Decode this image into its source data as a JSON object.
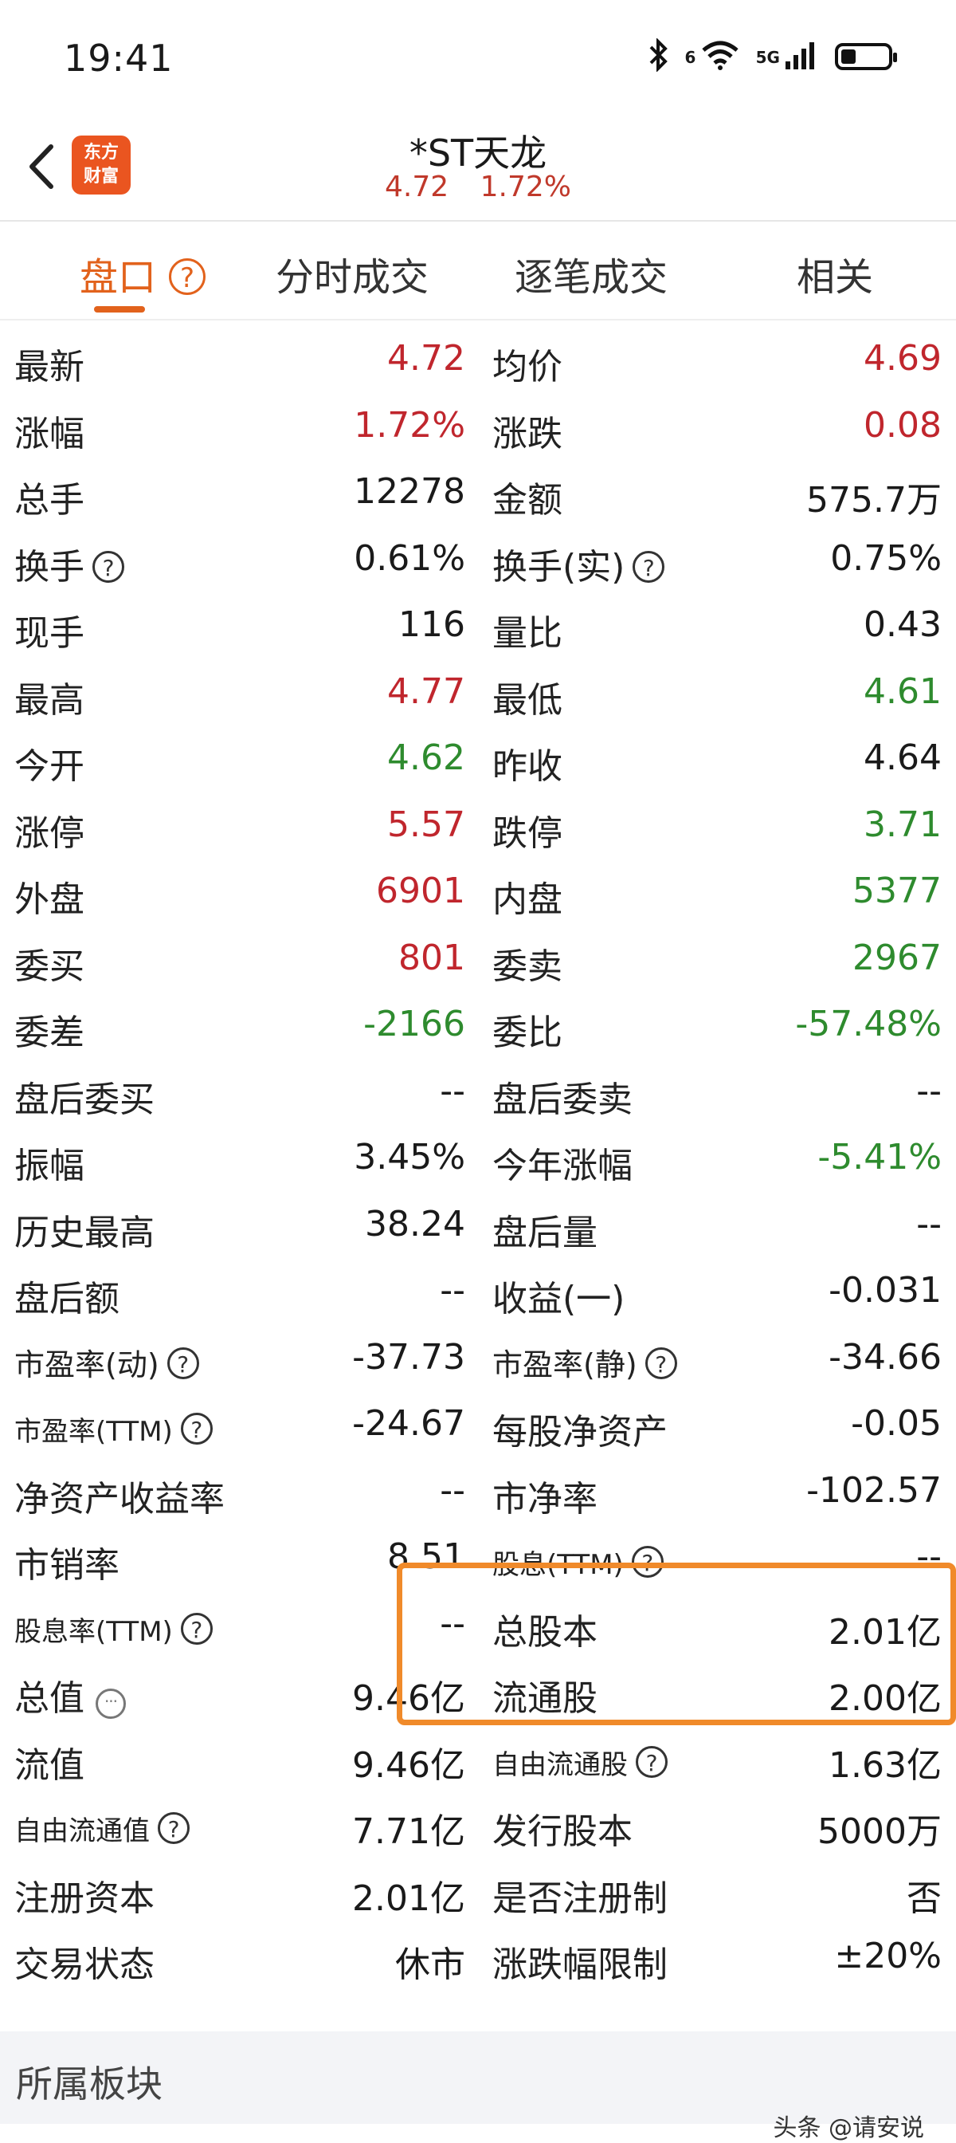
{
  "status_bar": {
    "time": "19:41",
    "icons": [
      "bluetooth-icon",
      "wifi-icon",
      "signal-icon",
      "battery-icon"
    ],
    "wifi_badge": "6",
    "network": "5G"
  },
  "header": {
    "back_icon": "chevron-left-icon",
    "logo_line1": "东方",
    "logo_line2": "财富",
    "stock_name": "*ST天龙",
    "price": "4.72",
    "change_pct": "1.72%"
  },
  "tabs": [
    {
      "label": "盘口",
      "active": true
    },
    {
      "label": "分时成交",
      "active": false
    },
    {
      "label": "逐笔成交",
      "active": false
    },
    {
      "label": "相关",
      "active": false
    }
  ],
  "rows": [
    {
      "l_label": "最新",
      "l_value": "4.72",
      "r_label": "均价",
      "r_value": "4.69"
    },
    {
      "l_label": "涨幅",
      "l_value": "1.72%",
      "r_label": "涨跌",
      "r_value": "0.08"
    },
    {
      "l_label": "总手",
      "l_value": "12278",
      "r_label": "金额",
      "r_value": "575.7万"
    },
    {
      "l_label": "换手",
      "l_value": "0.61%",
      "r_label": "换手(实)",
      "r_value": "0.75%"
    },
    {
      "l_label": "现手",
      "l_value": "116",
      "r_label": "量比",
      "r_value": "0.43"
    },
    {
      "l_label": "最高",
      "l_value": "4.77",
      "r_label": "最低",
      "r_value": "4.61"
    },
    {
      "l_label": "今开",
      "l_value": "4.62",
      "r_label": "昨收",
      "r_value": "4.64"
    },
    {
      "l_label": "涨停",
      "l_value": "5.57",
      "r_label": "跌停",
      "r_value": "3.71"
    },
    {
      "l_label": "外盘",
      "l_value": "6901",
      "r_label": "内盘",
      "r_value": "5377"
    },
    {
      "l_label": "委买",
      "l_value": "801",
      "r_label": "委卖",
      "r_value": "2967"
    },
    {
      "l_label": "委差",
      "l_value": "-2166",
      "r_label": "委比",
      "r_value": "-57.48%"
    },
    {
      "l_label": "盘后委买",
      "l_value": "--",
      "r_label": "盘后委卖",
      "r_value": "--"
    },
    {
      "l_label": "振幅",
      "l_value": "3.45%",
      "r_label": "今年涨幅",
      "r_value": "-5.41%"
    },
    {
      "l_label": "历史最高",
      "l_value": "38.24",
      "r_label": "盘后量",
      "r_value": "--"
    },
    {
      "l_label": "盘后额",
      "l_value": "--",
      "r_label": "收益(一)",
      "r_value": "-0.031"
    },
    {
      "l_label": "市盈率(动)",
      "l_value": "-37.73",
      "r_label": "市盈率(静)",
      "r_value": "-34.66"
    },
    {
      "l_label": "市盈率(TTM)",
      "l_value": "-24.67",
      "r_label": "每股净资产",
      "r_value": "-0.05"
    },
    {
      "l_label": "净资产收益率",
      "l_value": "--",
      "r_label": "市净率",
      "r_value": "-102.57"
    },
    {
      "l_label": "市销率",
      "l_value": "8.51",
      "r_label": "股息(TTM)",
      "r_value": "--"
    },
    {
      "l_label": "股息率(TTM)",
      "l_value": "--",
      "r_label": "总股本",
      "r_value": "2.01亿"
    },
    {
      "l_label": "总值",
      "l_value": "9.46亿",
      "r_label": "流通股",
      "r_value": "2.00亿"
    },
    {
      "l_label": "流值",
      "l_value": "9.46亿",
      "r_label": "自由流通股",
      "r_value": "1.63亿"
    },
    {
      "l_label": "自由流通值",
      "l_value": "7.71亿",
      "r_label": "发行股本",
      "r_value": "5000万"
    },
    {
      "l_label": "注册资本",
      "l_value": "2.01亿",
      "r_label": "是否注册制",
      "r_value": "否"
    },
    {
      "l_label": "交易状态",
      "l_value": "休市",
      "r_label": "涨跌幅限制",
      "r_value": "±20%"
    }
  ],
  "colors": {
    "up": "#c0262d",
    "down": "#2e8b2e",
    "accent": "#e2621c",
    "highlight_box": "#f08a2a"
  },
  "section": {
    "title": "所属板块",
    "watermark": "头条 @请安说"
  }
}
